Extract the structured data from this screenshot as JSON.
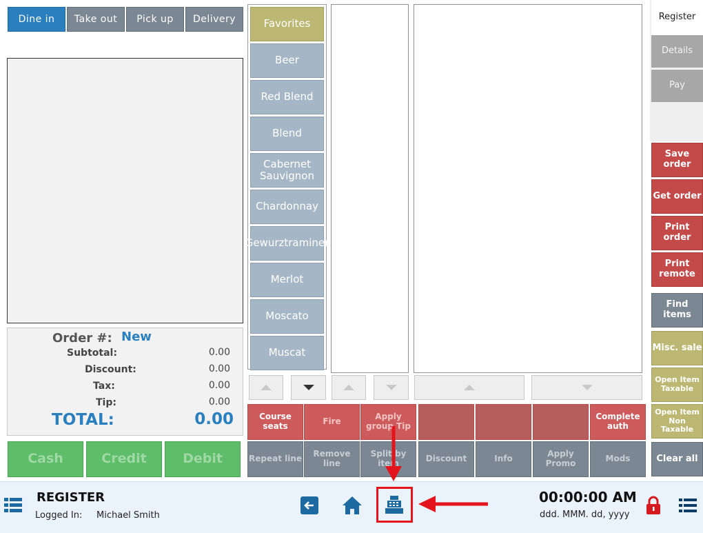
{
  "order_types": [
    "Dine in",
    "Take out",
    "Pick up",
    "Delivery"
  ],
  "categories": [
    "Favorites",
    "Beer",
    "Red Blend",
    "Blend",
    "Cabernet Sauvignon",
    "Chardonnay",
    "Gewurztraminer",
    "Merlot",
    "Moscato",
    "Muscat"
  ],
  "summary": {
    "order_label": "Order #:",
    "order_value": "New",
    "subtotal_label": "Subtotal:",
    "subtotal_value": "0.00",
    "discount_label": "Discount:",
    "discount_value": "0.00",
    "tax_label": "Tax:",
    "tax_value": "0.00",
    "tip_label": "Tip:",
    "tip_value": "0.00",
    "total_label": "TOTAL:",
    "total_value": "0.00"
  },
  "payment": {
    "cash": "Cash",
    "credit": "Credit",
    "debit": "Debit"
  },
  "actions_row1": [
    "Course seats",
    "Fire",
    "Apply group Tip",
    "",
    "",
    "",
    "Complete auth"
  ],
  "actions_row2": [
    "Repeat line",
    "Remove line",
    "Split by item",
    "Discount",
    "Info",
    "Apply Promo",
    "Mods"
  ],
  "right_tabs": {
    "register": "Register",
    "details": "Details",
    "pay": "Pay"
  },
  "right_actions": [
    "Save order",
    "Get order",
    "Print order",
    "Print remote",
    "Find items",
    "Misc. sale",
    "Open Item Taxable",
    "Open Item Non Taxable",
    "Clear all"
  ],
  "footer": {
    "title": "REGISTER",
    "logged_in_label": "Logged In:",
    "user": "Michael Smith",
    "time": "00:00:00 AM",
    "date": "ddd. MMM. dd, yyyy"
  },
  "colors": {
    "accent": "#2a7fbf",
    "annotation": "#e3141b",
    "footer_bg": "#eaf3fb"
  },
  "icons": [
    "menu-grid-icon",
    "back-arrow-icon",
    "home-icon",
    "cash-register-icon",
    "lock-icon",
    "list-icon"
  ]
}
